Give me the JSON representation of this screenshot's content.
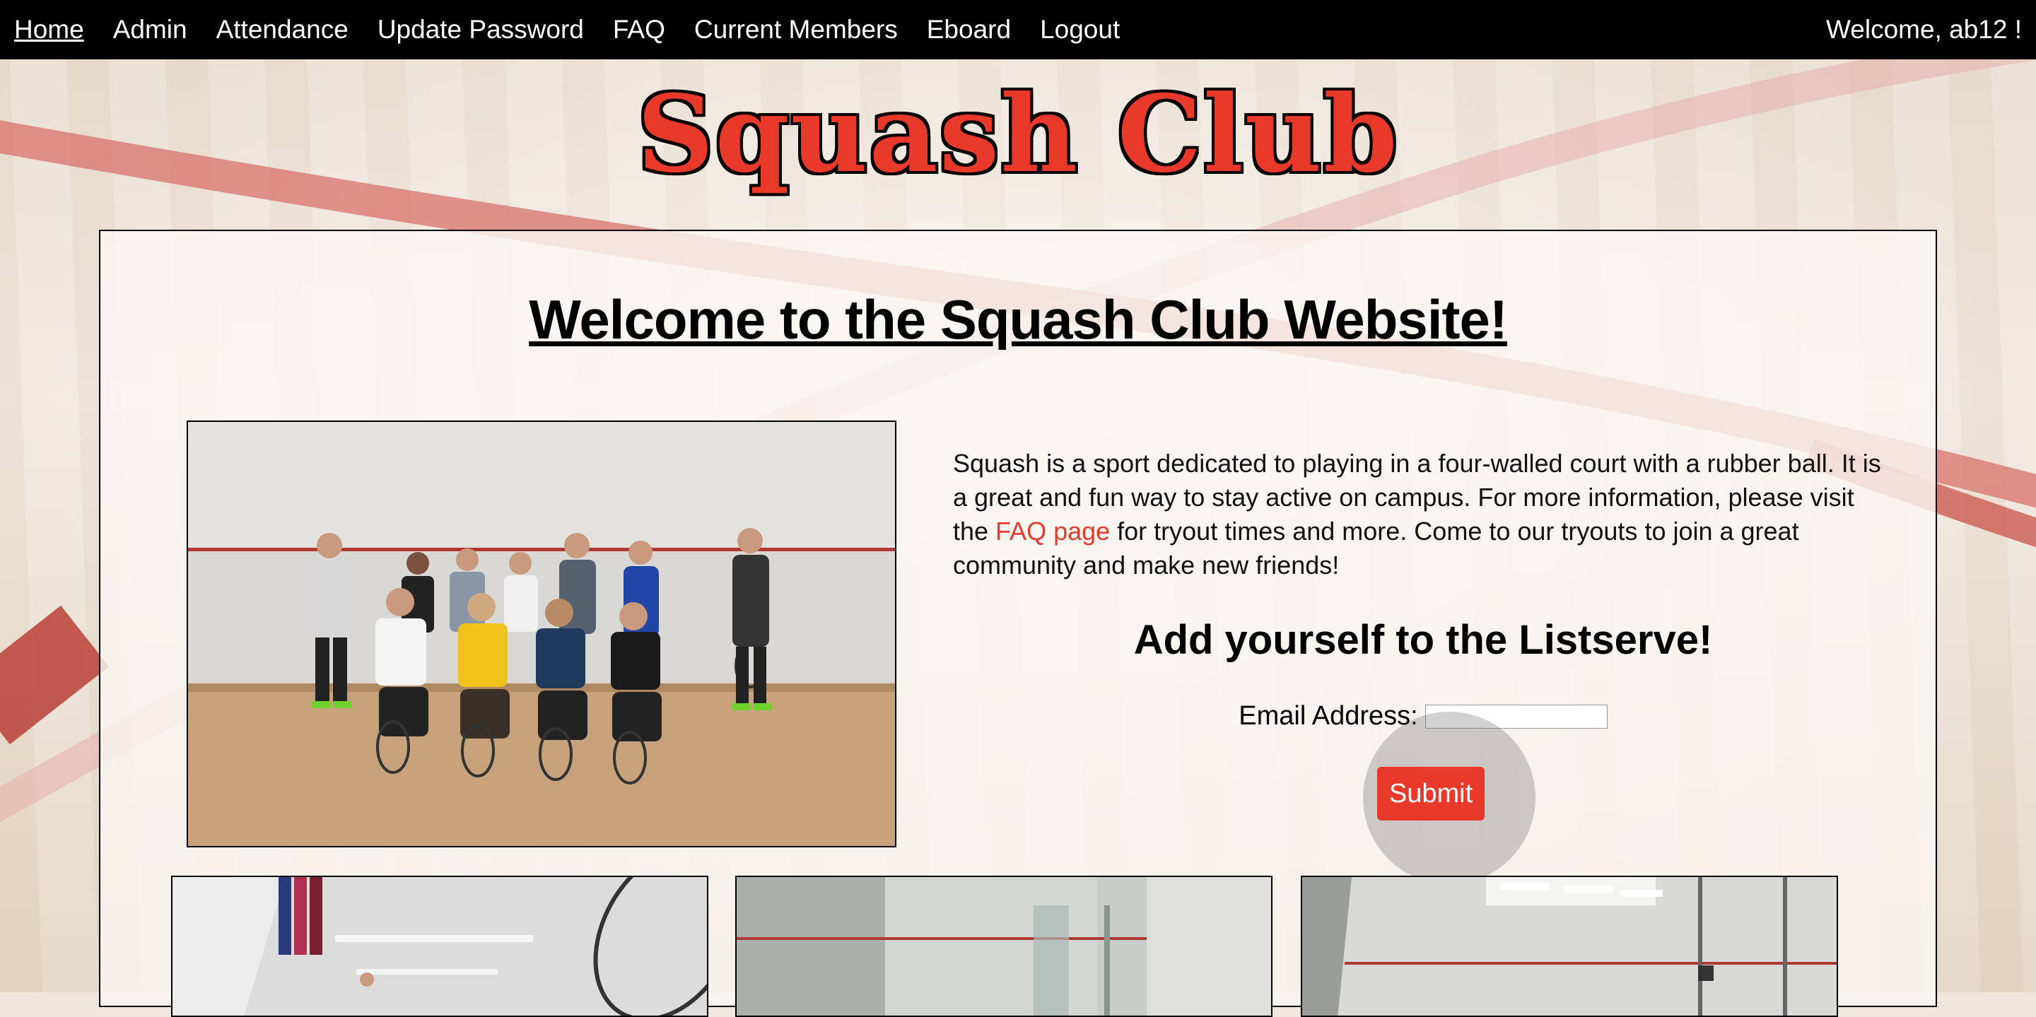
{
  "nav": {
    "items": [
      {
        "label": "Home",
        "active": true
      },
      {
        "label": "Admin",
        "active": false
      },
      {
        "label": "Attendance",
        "active": false
      },
      {
        "label": "Update Password",
        "active": false
      },
      {
        "label": "FAQ",
        "active": false
      },
      {
        "label": "Current Members",
        "active": false
      },
      {
        "label": "Eboard",
        "active": false
      },
      {
        "label": "Logout",
        "active": false
      }
    ],
    "welcome": "Welcome, ab12 !"
  },
  "site_title": "Squash Club",
  "main": {
    "heading": "Welcome to the Squash Club Website!",
    "intro_before_link": "Squash is a sport dedicated to playing in a four-walled court with a rubber ball. It is a great and fun way to stay active on campus. For more information, please visit the ",
    "intro_link": "FAQ page",
    "intro_after_link": " for tryout times and more. Come to our tryouts to join a great community and make new friends!",
    "listserve_heading": "Add yourself to the Listserve!",
    "email_label": "Email Address:",
    "email_value": "",
    "submit_label": "Submit"
  },
  "colors": {
    "accent": "#e8392b",
    "navbar": "#000000"
  }
}
